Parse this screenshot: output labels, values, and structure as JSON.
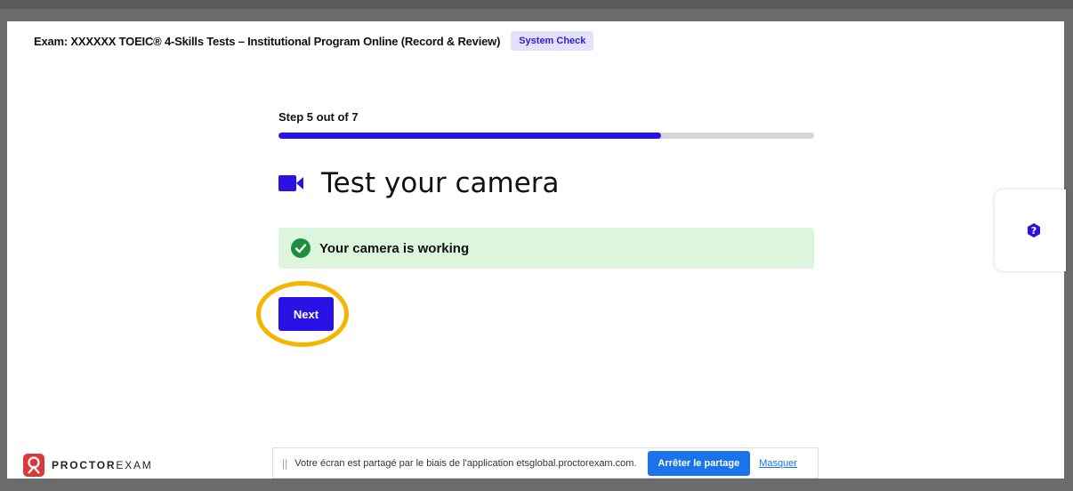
{
  "header": {
    "exam_title": "Exam: XXXXXX TOEIC® 4-Skills Tests – Institutional Program Online (Record & Review)",
    "badge": "System Check"
  },
  "wizard": {
    "step_label": "Step 5 out of 7",
    "progress_percent": 71.4,
    "heading": "Test your camera",
    "heading_icon": "video-camera-icon",
    "status_message": "Your camera is working",
    "status_icon": "check-circle-icon",
    "next_label": "Next"
  },
  "help": {
    "icon": "question-icon"
  },
  "logo": {
    "text_bold": "PROCTOR",
    "text_regular": "EXAM"
  },
  "share_bar": {
    "grip": "||",
    "message": "Votre écran est partagé par le biais de l'application etsglobal.proctorexam.com.",
    "stop_label": "Arrêter le partage",
    "hide_label": "Masquer"
  },
  "colors": {
    "accent": "#2a12e6",
    "success_bg": "#dcf5dc",
    "success_icon": "#1e8e3e",
    "highlight_ring": "#f4b400",
    "chrome_blue": "#1a73e8"
  }
}
